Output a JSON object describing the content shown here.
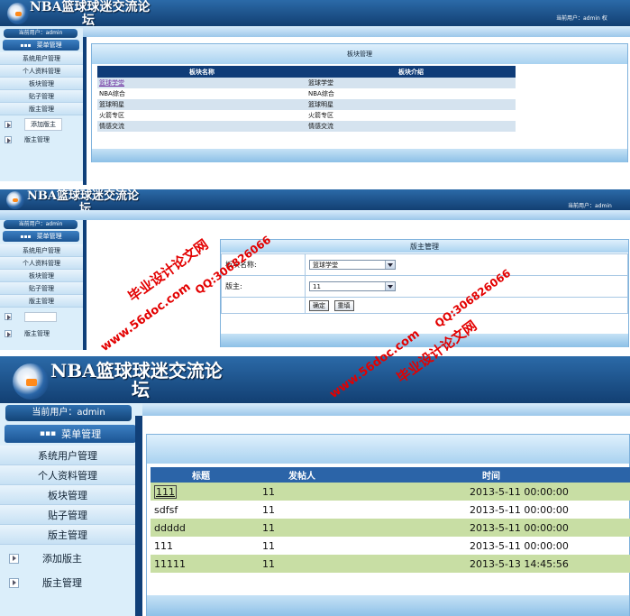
{
  "site": {
    "title_line1": "NBA篮球球迷交流论",
    "title_line2": "坛"
  },
  "user": {
    "top_text": "当前用户：admin",
    "top_text_trunc": "当前用户：admin 权",
    "side_text": "当前用户：admin"
  },
  "menu": {
    "header": "菜单管理",
    "items": [
      "系统用户管理",
      "个人资料管理",
      "板块管理",
      "贴子管理",
      "版主管理"
    ],
    "subitems": [
      "添加版主",
      "版主管理"
    ]
  },
  "panel1": {
    "title": "板块管理",
    "columns": [
      "板块名称",
      "板块介绍"
    ],
    "rows": [
      [
        "篮球学堂",
        "篮球学堂"
      ],
      [
        "NBA综合",
        "NBA综合"
      ],
      [
        "篮球明星",
        "篮球明星"
      ],
      [
        "火箭专区",
        "火箭专区"
      ],
      [
        "情感交流",
        "情感交流"
      ]
    ]
  },
  "panel2": {
    "title": "版主管理",
    "board_label": "板块名称:",
    "board_value": "篮球学堂",
    "mod_label": "版主:",
    "mod_value": "11",
    "ok_button": "确定",
    "reset_button": "重填"
  },
  "panel3": {
    "columns": [
      "标题",
      "发帖人",
      "时间"
    ],
    "rows": [
      [
        "111",
        "11",
        "2013-5-11 00:00:00"
      ],
      [
        "sdfsf",
        "11",
        "2013-5-11 00:00:00"
      ],
      [
        "ddddd",
        "11",
        "2013-5-11 00:00:00"
      ],
      [
        "111",
        "11",
        "2013-5-11 00:00:00"
      ],
      [
        "11111",
        "11",
        "2013-5-13 14:45:56"
      ]
    ]
  },
  "watermarks": {
    "cn": "毕业设计论文网",
    "site": "www.56doc.com",
    "qq": "QQ:306826066"
  },
  "colors": {
    "nav_dark": "#123f72",
    "sidebar": "#dbeefa",
    "row_green": "#c8dea4",
    "table_header": "#0f3c78",
    "watermark": "#e30000"
  }
}
